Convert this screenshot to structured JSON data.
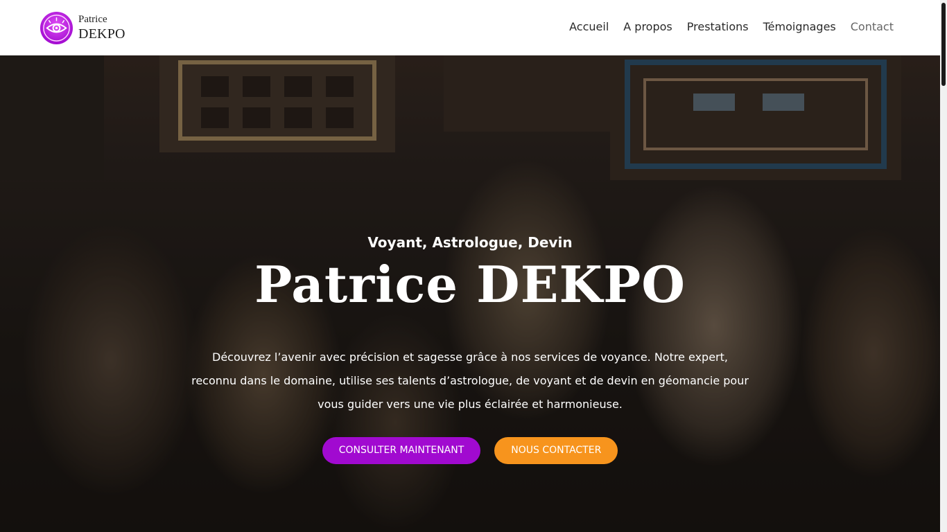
{
  "header": {
    "logo": {
      "line1": "Patrice",
      "line2": "DEKPO"
    },
    "nav": [
      {
        "label": "Accueil"
      },
      {
        "label": "A propos"
      },
      {
        "label": "Prestations"
      },
      {
        "label": "Témoignages"
      },
      {
        "label": "Contact"
      }
    ]
  },
  "hero": {
    "subtitle": "Voyant, Astrologue, Devin",
    "title": "Patrice DEKPO",
    "description": "Découvrez l’avenir avec précision et sagesse grâce à nos services de voyance. Notre expert, reconnu dans le domaine, utilise ses talents d’astrologue, de voyant et de devin en géomancie pour vous guider vers une vie plus éclairée et harmonieuse.",
    "primary_button": "CONSULTER MAINTENANT",
    "secondary_button": "NOUS CONTACTER"
  },
  "colors": {
    "brand_purple": "#a10ad0",
    "accent_orange": "#f7941d",
    "header_bg": "#ffffff"
  },
  "icons": {
    "logo": "eye-icon"
  }
}
